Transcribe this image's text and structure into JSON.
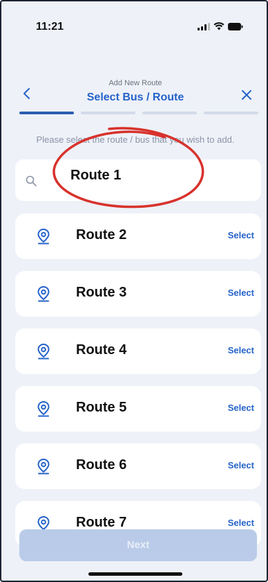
{
  "status_bar": {
    "time": "11:21"
  },
  "header": {
    "subtitle": "Add New Route",
    "title": "Select Bus / Route",
    "back_icon": "chevron-left-icon",
    "close_icon": "close-icon",
    "progress_steps": 4,
    "progress_active": 1
  },
  "instruction": "Please select the route / bus that you wish to add.",
  "search": {
    "value": "Route 1",
    "icon": "search-icon"
  },
  "routes": [
    {
      "label": "Route 2",
      "action": "Select"
    },
    {
      "label": "Route 3",
      "action": "Select"
    },
    {
      "label": "Route 4",
      "action": "Select"
    },
    {
      "label": "Route 5",
      "action": "Select"
    },
    {
      "label": "Route 6",
      "action": "Select"
    },
    {
      "label": "Route 7",
      "action": "Select"
    }
  ],
  "footer": {
    "next_label": "Next"
  },
  "colors": {
    "accent": "#2563c9",
    "progress_active": "#2b5fb0",
    "background": "#eef1f8",
    "annotation": "#d8322c",
    "next_disabled": "#b9cbe8"
  }
}
